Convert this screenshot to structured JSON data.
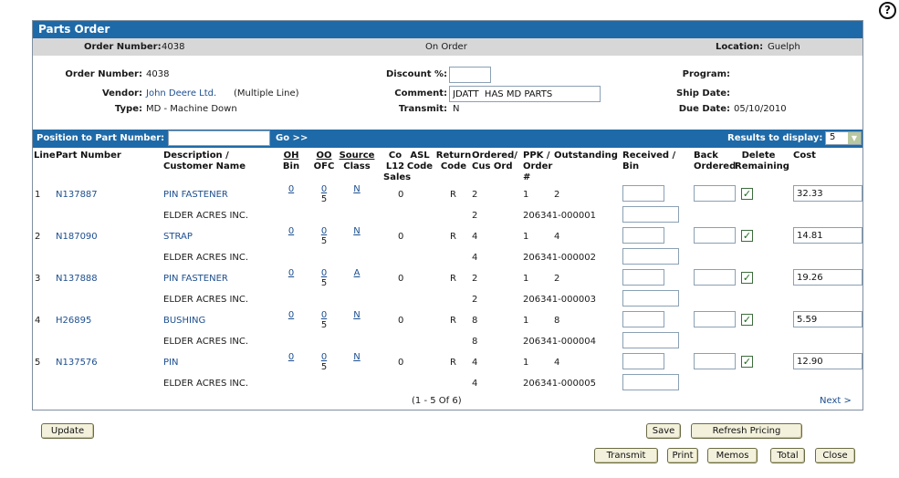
{
  "help": {
    "glyph": "?"
  },
  "panel": {
    "title": "Parts Order"
  },
  "summary": {
    "order_label": "Order Number:",
    "order_value": "4038",
    "status": "On Order",
    "location_label": "Location:",
    "location_value": "Guelph"
  },
  "details": {
    "order_label": "Order Number:",
    "order_value": "4038",
    "vendor_label": "Vendor:",
    "vendor_value": "John Deere Ltd.",
    "vendor_note": "(Multiple Line)",
    "type_label": "Type:",
    "type_value": "MD - Machine Down",
    "discount_label": "Discount %:",
    "discount_value": "",
    "comment_label": "Comment:",
    "comment_value": "JDATT  HAS MD PARTS",
    "transmit_label": "Transmit:",
    "transmit_value": "N",
    "program_label": "Program:",
    "program_value": "",
    "ship_label": "Ship Date:",
    "ship_value": "",
    "due_label": "Due Date:",
    "due_value": "05/10/2010"
  },
  "nav": {
    "position_label": "Position to Part Number:",
    "position_value": "",
    "go_label": "Go >>",
    "results_label": "Results to display:",
    "results_value": "5"
  },
  "headers": {
    "line": "Line",
    "part": "Part Number",
    "desc1": "Description /",
    "desc2": "Customer Name",
    "oh1": "OH",
    "oh2": "Bin",
    "oo1": "OO",
    "oo2": "OFC",
    "src1": "Source",
    "src2": "Class",
    "co1": "Co",
    "co2": "L12",
    "co3": "Sales",
    "asl1": "ASL",
    "asl2": "Code",
    "ret1": "Return",
    "ret2": "Code",
    "ord1": "Ordered/",
    "ord2": "Cus Ord",
    "ppk1": "PPK /",
    "ppk2": "Order",
    "ppk3": "#",
    "out1": "Outstanding",
    "rec1": "Received /",
    "rec2": "Bin",
    "back1": "Back",
    "back2": "Ordered",
    "del1": "Delete",
    "del2": "Remaining",
    "cost": "Cost"
  },
  "rows": [
    {
      "line": "1",
      "part": "N137887",
      "desc": "PIN FASTENER",
      "customer": "ELDER ACRES INC.",
      "oh": "0",
      "oo": "0",
      "ofc": "5",
      "source": "N",
      "co": "0",
      "ret": "R",
      "ordered": "2",
      "cus_ord": "2",
      "ppk": "1",
      "outstanding": "2",
      "order_no": "206341-000001",
      "received": "",
      "bin": "",
      "back": "",
      "delete": true,
      "cost": "32.33"
    },
    {
      "line": "2",
      "part": "N187090",
      "desc": "STRAP",
      "customer": "ELDER ACRES INC.",
      "oh": "0",
      "oo": "0",
      "ofc": "5",
      "source": "N",
      "co": "0",
      "ret": "R",
      "ordered": "4",
      "cus_ord": "4",
      "ppk": "1",
      "outstanding": "4",
      "order_no": "206341-000002",
      "received": "",
      "bin": "",
      "back": "",
      "delete": true,
      "cost": "14.81"
    },
    {
      "line": "3",
      "part": "N137888",
      "desc": "PIN FASTENER",
      "customer": "ELDER ACRES INC.",
      "oh": "0",
      "oo": "0",
      "ofc": "5",
      "source": "A",
      "co": "0",
      "ret": "R",
      "ordered": "2",
      "cus_ord": "2",
      "ppk": "1",
      "outstanding": "2",
      "order_no": "206341-000003",
      "received": "",
      "bin": "",
      "back": "",
      "delete": true,
      "cost": "19.26"
    },
    {
      "line": "4",
      "part": "H26895",
      "desc": "BUSHING",
      "customer": "ELDER ACRES INC.",
      "oh": "0",
      "oo": "0",
      "ofc": "5",
      "source": "N",
      "co": "0",
      "ret": "R",
      "ordered": "8",
      "cus_ord": "8",
      "ppk": "1",
      "outstanding": "8",
      "order_no": "206341-000004",
      "received": "",
      "bin": "",
      "back": "",
      "delete": true,
      "cost": "5.59"
    },
    {
      "line": "5",
      "part": "N137576",
      "desc": "PIN",
      "customer": "ELDER ACRES INC.",
      "oh": "0",
      "oo": "0",
      "ofc": "5",
      "source": "N",
      "co": "0",
      "ret": "R",
      "ordered": "4",
      "cus_ord": "4",
      "ppk": "1",
      "outstanding": "4",
      "order_no": "206341-000005",
      "received": "",
      "bin": "",
      "back": "",
      "delete": true,
      "cost": "12.90"
    }
  ],
  "pagination": {
    "range": "(1 - 5 Of 6)",
    "next": "Next >"
  },
  "buttons": {
    "update": "Update",
    "save": "Save",
    "refresh": "Refresh Pricing",
    "transmit": "Transmit",
    "print": "Print",
    "memos": "Memos",
    "total": "Total",
    "close": "Close"
  }
}
